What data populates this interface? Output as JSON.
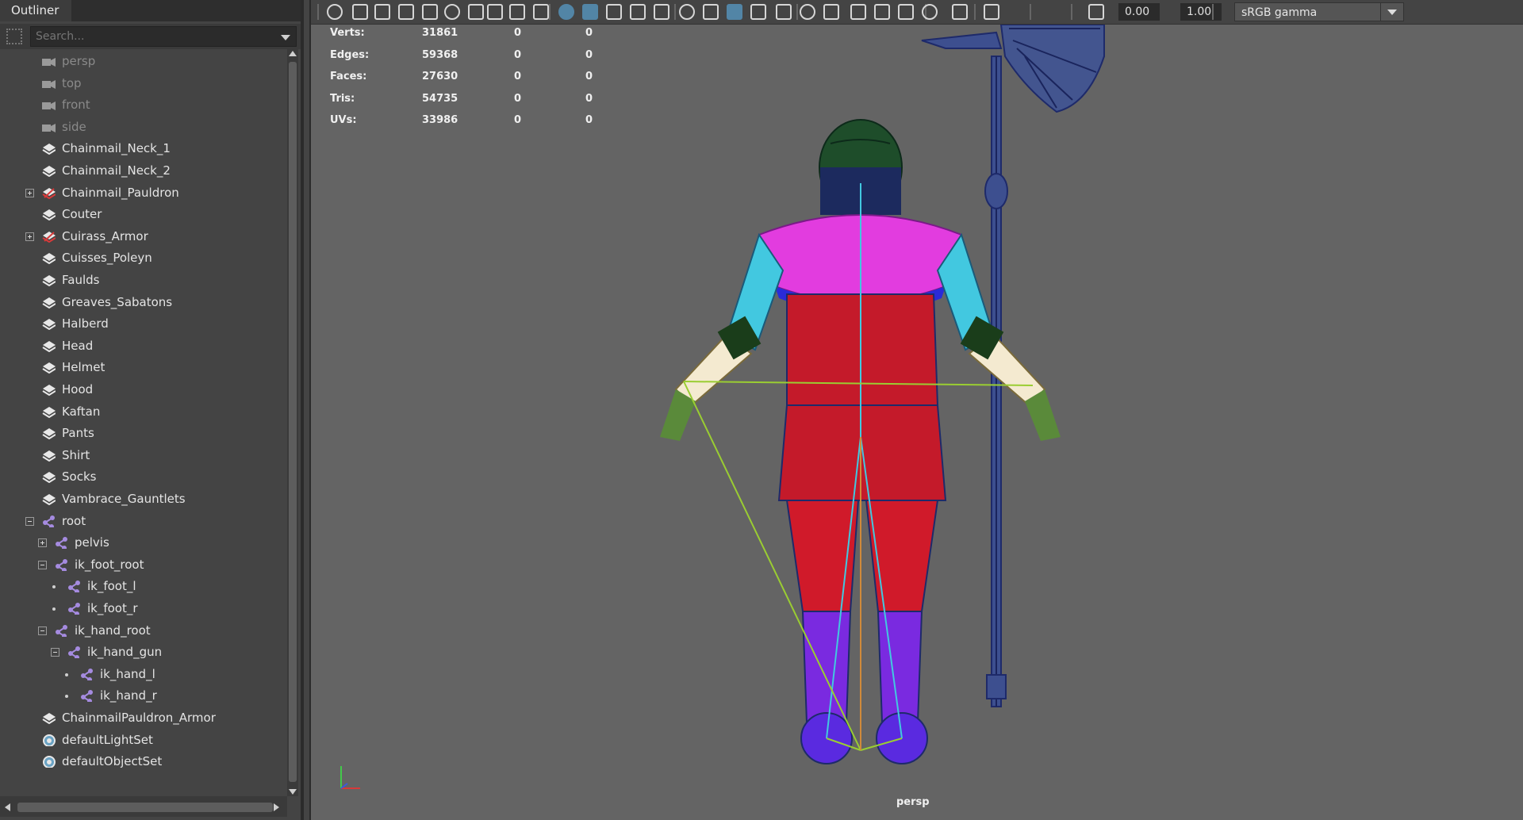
{
  "outliner": {
    "tab_label": "Outliner",
    "search_placeholder": "Search...",
    "items": [
      {
        "label": "persp",
        "type": "camera",
        "dim": true
      },
      {
        "label": "top",
        "type": "camera",
        "dim": true
      },
      {
        "label": "front",
        "type": "camera",
        "dim": true
      },
      {
        "label": "side",
        "type": "camera",
        "dim": true
      },
      {
        "label": "Chainmail_Neck_1",
        "type": "mesh"
      },
      {
        "label": "Chainmail_Neck_2",
        "type": "mesh"
      },
      {
        "label": "Chainmail_Pauldron",
        "type": "group",
        "expander": "plus"
      },
      {
        "label": "Couter",
        "type": "mesh"
      },
      {
        "label": "Cuirass_Armor",
        "type": "group",
        "expander": "plus"
      },
      {
        "label": "Cuisses_Poleyn",
        "type": "mesh"
      },
      {
        "label": "Faulds",
        "type": "mesh"
      },
      {
        "label": "Greaves_Sabatons",
        "type": "mesh"
      },
      {
        "label": "Halberd",
        "type": "mesh"
      },
      {
        "label": "Head",
        "type": "mesh"
      },
      {
        "label": "Helmet",
        "type": "mesh"
      },
      {
        "label": "Hood",
        "type": "mesh"
      },
      {
        "label": "Kaftan",
        "type": "mesh"
      },
      {
        "label": "Pants",
        "type": "mesh"
      },
      {
        "label": "Shirt",
        "type": "mesh"
      },
      {
        "label": "Socks",
        "type": "mesh"
      },
      {
        "label": "Vambrace_Gauntlets",
        "type": "mesh"
      },
      {
        "label": "root",
        "type": "joint",
        "expander": "minus"
      },
      {
        "label": "pelvis",
        "type": "joint",
        "expander": "plus"
      },
      {
        "label": "ik_foot_root",
        "type": "joint",
        "expander": "minus"
      },
      {
        "label": "ik_foot_l",
        "type": "joint"
      },
      {
        "label": "ik_foot_r",
        "type": "joint"
      },
      {
        "label": "ik_hand_root",
        "type": "joint",
        "expander": "minus"
      },
      {
        "label": "ik_hand_gun",
        "type": "joint",
        "expander": "minus"
      },
      {
        "label": "ik_hand_l",
        "type": "joint"
      },
      {
        "label": "ik_hand_r",
        "type": "joint"
      },
      {
        "label": "ChainmailPauldron_Armor",
        "type": "mesh"
      },
      {
        "label": "defaultLightSet",
        "type": "set"
      },
      {
        "label": "defaultObjectSet",
        "type": "set"
      }
    ]
  },
  "toolbar": {
    "exposure_value": "0.00",
    "gamma_value": "1.00",
    "color_space": "sRGB gamma",
    "icons": [
      "select-camera-icon",
      "camera-attributes-icon",
      "bookmark-icon",
      "image-plane-icon",
      "grid-icon",
      "film-gate-icon",
      "resolution-gate-icon",
      "gate-mask-icon",
      "field-chart-icon",
      "safe-action-icon",
      "safe-title-icon",
      "wireframe-icon",
      "smooth-shade-icon",
      "default-material-icon",
      "wireframe-on-shaded-icon",
      "textured-icon",
      "use-all-lights-icon",
      "shadows-icon",
      "ambient-occlusion-icon",
      "motion-blur-icon",
      "anti-aliasing-icon",
      "depth-of-field-icon",
      "isolate-select-icon",
      "xray-icon",
      "xray-joints-icon",
      "xray-components-icon",
      "exposure-icon",
      "gamma-icon",
      "color-management-icon"
    ]
  },
  "hud": {
    "rows": [
      {
        "label": "Verts:",
        "v1": "31861",
        "v2": "0",
        "v3": "0"
      },
      {
        "label": "Edges:",
        "v1": "59368",
        "v2": "0",
        "v3": "0"
      },
      {
        "label": "Faces:",
        "v1": "27630",
        "v2": "0",
        "v3": "0"
      },
      {
        "label": "Tris:",
        "v1": "54735",
        "v2": "0",
        "v3": "0"
      },
      {
        "label": "UVs:",
        "v1": "33986",
        "v2": "0",
        "v3": "0"
      }
    ]
  },
  "viewport": {
    "camera_label": "persp"
  },
  "colors": {
    "viewport_bg": "#646464",
    "panel_bg": "#444444",
    "accent": "#5285a6",
    "joint": "#a58be0"
  }
}
